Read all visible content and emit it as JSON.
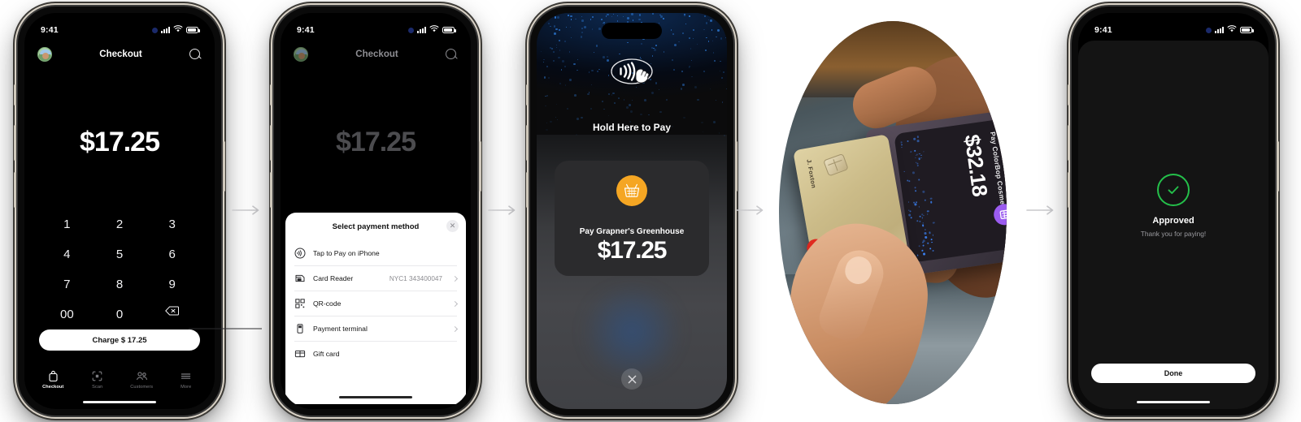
{
  "statusbar": {
    "time": "9:41"
  },
  "screen1": {
    "nav_title": "Checkout",
    "avatar_name": "merchant-avatar",
    "amount": "$17.25",
    "keys": [
      "1",
      "2",
      "3",
      "4",
      "5",
      "6",
      "7",
      "8",
      "9",
      "00",
      "0",
      "delete"
    ],
    "charge_label": "Charge $ 17.25",
    "tabs": [
      {
        "label": "Checkout",
        "icon": "bag-icon",
        "active": true
      },
      {
        "label": "Scan",
        "icon": "scan-icon",
        "active": false
      },
      {
        "label": "Customers",
        "icon": "customers-icon",
        "active": false
      },
      {
        "label": "More",
        "icon": "more-icon",
        "active": false
      }
    ]
  },
  "screen2": {
    "nav_title": "Checkout",
    "amount": "$17.25",
    "sheet": {
      "title": "Select payment method",
      "close_label": "✕",
      "rows": [
        {
          "label": "Tap to Pay on iPhone",
          "value": "",
          "icon": "contactless-icon",
          "chevron": false
        },
        {
          "label": "Card Reader",
          "value": "NYC1 343400047",
          "icon": "card-reader-icon",
          "chevron": true
        },
        {
          "label": "QR-code",
          "value": "",
          "icon": "qr-code-icon",
          "chevron": true
        },
        {
          "label": "Payment terminal",
          "value": "",
          "icon": "terminal-icon",
          "chevron": true
        },
        {
          "label": "Gift card",
          "value": "",
          "icon": "gift-card-icon",
          "chevron": false
        }
      ]
    }
  },
  "screen3": {
    "hold_text": "Hold Here to Pay",
    "merchant": "Pay Grapner's Greenhouse",
    "amount": "$17.25",
    "basket_icon": "shopping-basket-icon",
    "nfc_icon": "contactless-hand-icon",
    "close_icon": "close-icon"
  },
  "photo": {
    "pay_text": "Pay ColorBop Cosmetics",
    "amount": "$32.18",
    "card_name": "J. Foxton",
    "card_network": "mastercard",
    "app_icon": "wallet-app-icon"
  },
  "screen5": {
    "status_icon": "check-circle-icon",
    "title": "Approved",
    "subtitle": "Thank you for paying!",
    "done_label": "Done"
  },
  "arrows": {
    "icon": "arrow-right-icon",
    "count": 4
  },
  "colors": {
    "accent_orange": "#f5a623",
    "success_green": "#24c04a",
    "app_purple": "#9b5cf0",
    "sparkle_blue": "#2f7fe0",
    "phone_screen_black": "#0a0a0a"
  }
}
